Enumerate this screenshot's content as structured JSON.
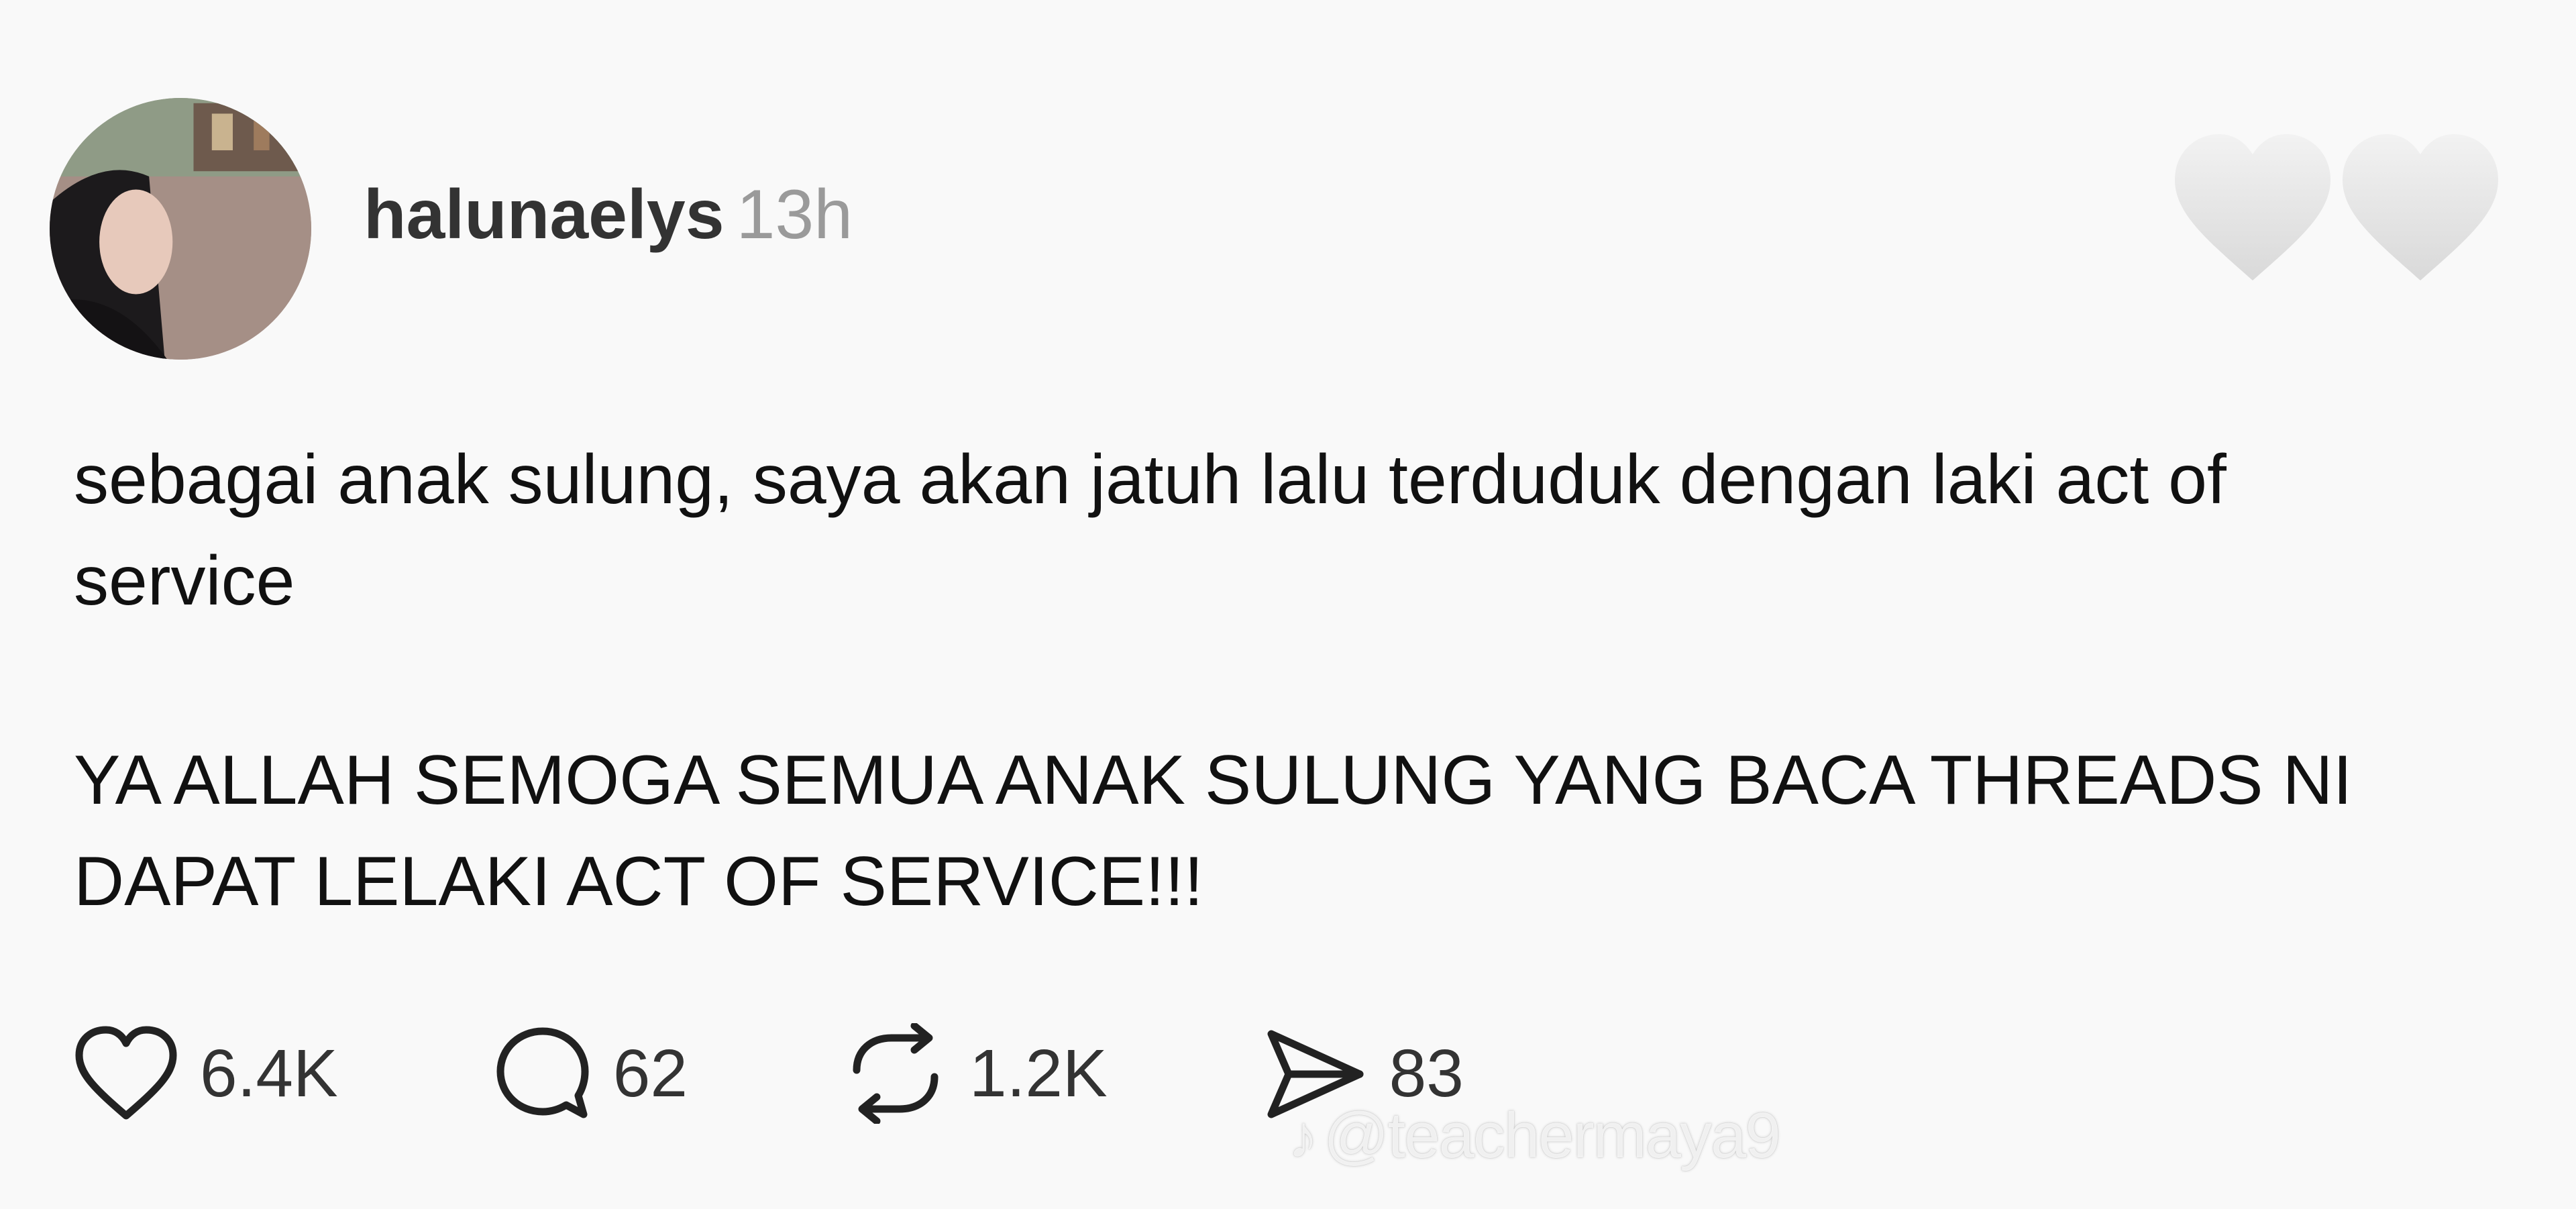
{
  "post": {
    "username": "halunaelys",
    "timestamp": "13h",
    "paragraphs": [
      "sebagai anak sulung, saya akan jatuh lalu terduduk dengan laki act of service",
      "YA ALLAH SEMOGA SEMUA ANAK SULUNG YANG BACA THREADS NI DAPAT LELAKI ACT OF SERVICE!!!"
    ],
    "decoration_icons": [
      "white-heart-icon",
      "white-heart-icon"
    ]
  },
  "actions": {
    "like": {
      "icon": "heart-outline-icon",
      "count": "6.4K"
    },
    "reply": {
      "icon": "comment-bubble-icon",
      "count": "62"
    },
    "repost": {
      "icon": "repost-icon",
      "count": "1.2K"
    },
    "share": {
      "icon": "send-icon",
      "count": "83"
    }
  },
  "watermark": {
    "icon": "tiktok-logo-icon",
    "text": "@teachermaya9"
  },
  "colors": {
    "background": "#f9f9f9",
    "text": "#111111",
    "muted": "#9a9a9a",
    "heart": "#e6e6e6"
  }
}
